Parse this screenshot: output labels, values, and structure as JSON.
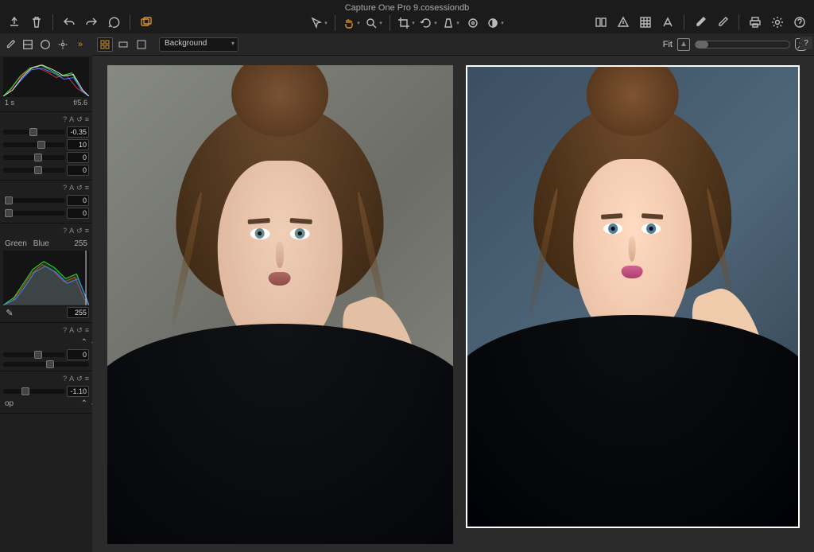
{
  "window": {
    "title": "Capture One Pro 9.cosessiondb"
  },
  "breadcrumb": {
    "current": "Background"
  },
  "viewer": {
    "fit_label": "Fit"
  },
  "exposure": {
    "seconds_label": "1 s",
    "aperture_label": "f/5.6"
  },
  "panel_icons": {
    "help": "?",
    "auto": "A",
    "reset": "↺",
    "menu": "≡"
  },
  "sliders": {
    "exposure_adj": "-0.35",
    "contrast": "10",
    "brightness": "0",
    "saturation": "0",
    "hdr_highlight": "0",
    "hdr_shadow": "0",
    "level_high": "255",
    "level_pick": "255",
    "clarity_value": "0",
    "vignette": "-1.10"
  },
  "levels": {
    "tabs": [
      "Green",
      "Blue"
    ]
  },
  "vignette": {
    "mode_label": "op"
  },
  "clarity": {
    "step_label": ""
  }
}
